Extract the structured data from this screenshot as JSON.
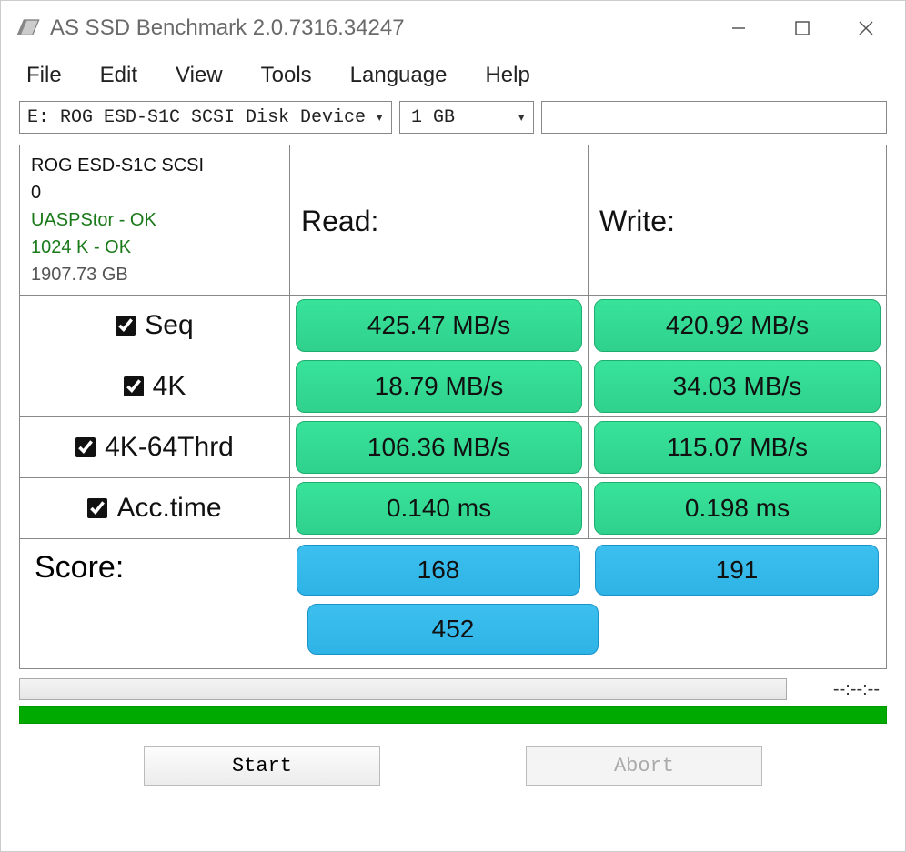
{
  "window": {
    "title": "AS SSD Benchmark 2.0.7316.34247"
  },
  "menu": {
    "file": "File",
    "edit": "Edit",
    "view": "View",
    "tools": "Tools",
    "language": "Language",
    "help": "Help"
  },
  "selectors": {
    "drive": "E: ROG ESD-S1C SCSI Disk Device",
    "size": "1 GB"
  },
  "drive_info": {
    "name": "ROG ESD-S1C SCSI",
    "index": "0",
    "uasp": "UASPStor - OK",
    "align": "1024 K - OK",
    "capacity": "1907.73 GB"
  },
  "headers": {
    "read": "Read:",
    "write": "Write:"
  },
  "rows": {
    "seq": {
      "label": "Seq",
      "checked": true,
      "read": "425.47 MB/s",
      "write": "420.92 MB/s"
    },
    "k4": {
      "label": "4K",
      "checked": true,
      "read": "18.79 MB/s",
      "write": "34.03 MB/s"
    },
    "k464": {
      "label": "4K-64Thrd",
      "checked": true,
      "read": "106.36 MB/s",
      "write": "115.07 MB/s"
    },
    "acc": {
      "label": "Acc.time",
      "checked": true,
      "read": "0.140 ms",
      "write": "0.198 ms"
    }
  },
  "score": {
    "label": "Score:",
    "read": "168",
    "write": "191",
    "total": "452"
  },
  "progress": {
    "timer": "--:--:--"
  },
  "buttons": {
    "start": "Start",
    "abort": "Abort"
  }
}
